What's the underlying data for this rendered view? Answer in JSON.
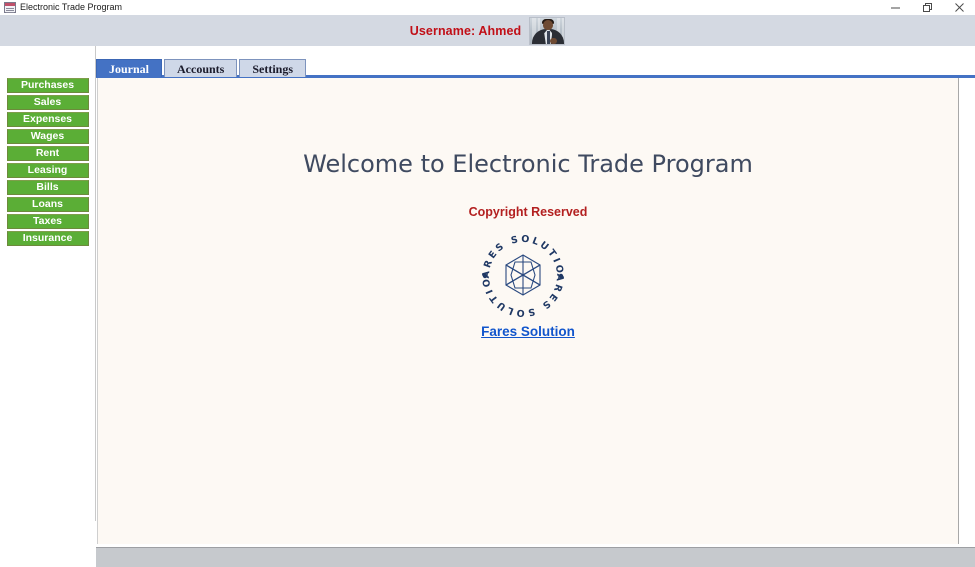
{
  "window": {
    "title": "Electronic Trade Program",
    "icon": "form-window-icon",
    "controls": [
      {
        "name": "minimize-button",
        "label": "Minimize",
        "glyph": "minimize"
      },
      {
        "name": "restore-button",
        "label": "Restore Down",
        "glyph": "restore"
      },
      {
        "name": "close-button",
        "label": "Close",
        "glyph": "close"
      }
    ]
  },
  "header": {
    "username_label": "Username: Ahmed",
    "avatar_alt": "user-photo",
    "background_color": "#d4d9e2",
    "username_color": "#c10f17"
  },
  "sidebar": {
    "items": [
      {
        "label": "Purchases"
      },
      {
        "label": "Sales"
      },
      {
        "label": "Expenses"
      },
      {
        "label": "Wages"
      },
      {
        "label": "Rent"
      },
      {
        "label": "Leasing"
      },
      {
        "label": "Bills"
      },
      {
        "label": "Loans"
      },
      {
        "label": "Taxes"
      },
      {
        "label": "Insurance"
      }
    ],
    "button_color": "#5bae36",
    "button_border_color": "#6d8a3c",
    "button_text_color": "#ffffff"
  },
  "tabs": {
    "items": [
      {
        "label": "Journal",
        "selected": true
      },
      {
        "label": "Accounts",
        "selected": false
      },
      {
        "label": "Settings",
        "selected": false
      }
    ],
    "accent_color": "#4472c4",
    "inactive_color": "#cfd8e8"
  },
  "content": {
    "background_color": "#fdf9f4",
    "welcome_title": "Welcome to Electronic Trade Program",
    "welcome_title_color": "#3f4a60",
    "copyright_text": "Copyright Reserved",
    "copyright_color": "#b32020",
    "logo": {
      "name": "fares-solution-logo",
      "ring_text_top": "FARES SOLUTION",
      "ring_text_bottom": "FARES SOLUTION",
      "color": "#1f3864"
    },
    "link": {
      "label": "Fares Solution",
      "color": "#1155cc"
    }
  },
  "statusbar": {
    "text": "",
    "background_color": "#c6c9cd"
  },
  "scrollbar": {
    "splitter_arrow": "right-arrow-icon"
  }
}
